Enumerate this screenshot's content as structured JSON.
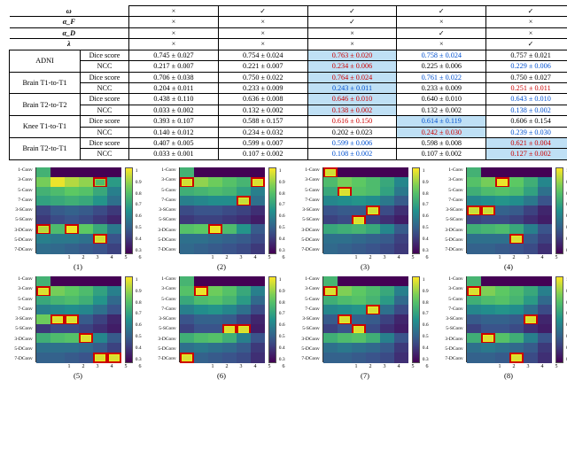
{
  "header_rows": [
    "ω",
    "α_F",
    "α_D",
    "λ"
  ],
  "col_marks": [
    [
      "×",
      "✓",
      "✓",
      "✓",
      "✓"
    ],
    [
      "×",
      "×",
      "✓",
      "×",
      "×"
    ],
    [
      "×",
      "×",
      "×",
      "✓",
      "×"
    ],
    [
      "×",
      "×",
      "×",
      "×",
      "✓"
    ]
  ],
  "datasets": [
    {
      "name": "ADNI",
      "rows": [
        {
          "metric": "Dice score",
          "v": [
            {
              "t": "0.745 ± 0.027"
            },
            {
              "t": "0.754 ± 0.024"
            },
            {
              "t": "0.763 ± 0.020",
              "hl": true,
              "c": "red"
            },
            {
              "t": "0.758 ± 0.024",
              "c": "blue"
            },
            {
              "t": "0.757 ± 0.021"
            }
          ]
        },
        {
          "metric": "NCC",
          "v": [
            {
              "t": "0.217 ± 0.007"
            },
            {
              "t": "0.221 ± 0.007"
            },
            {
              "t": "0.234 ± 0.006",
              "hl": true,
              "c": "red"
            },
            {
              "t": "0.225 ± 0.006"
            },
            {
              "t": "0.229 ± 0.006",
              "c": "blue"
            }
          ]
        }
      ]
    },
    {
      "name": "Brain T1-to-T1",
      "rows": [
        {
          "metric": "Dice score",
          "v": [
            {
              "t": "0.706 ± 0.038"
            },
            {
              "t": "0.750 ± 0.022"
            },
            {
              "t": "0.764 ± 0.024",
              "hl": true,
              "c": "red"
            },
            {
              "t": "0.761 ± 0.022",
              "c": "blue"
            },
            {
              "t": "0.750 ± 0.027"
            }
          ]
        },
        {
          "metric": "NCC",
          "v": [
            {
              "t": "0.204 ± 0.011"
            },
            {
              "t": "0.233 ± 0.009"
            },
            {
              "t": "0.243 ± 0.011",
              "hl": true,
              "c": "blue"
            },
            {
              "t": "0.233 ± 0.009"
            },
            {
              "t": "0.251 ± 0.011",
              "c": "red"
            }
          ]
        }
      ]
    },
    {
      "name": "Brain T2-to-T2",
      "rows": [
        {
          "metric": "Dice score",
          "v": [
            {
              "t": "0.438 ± 0.110"
            },
            {
              "t": "0.636 ± 0.008"
            },
            {
              "t": "0.646 ± 0.010",
              "hl": true,
              "c": "red"
            },
            {
              "t": "0.640 ± 0.010"
            },
            {
              "t": "0.643 ± 0.010",
              "c": "blue"
            }
          ]
        },
        {
          "metric": "NCC",
          "v": [
            {
              "t": "0.033 ± 0.002"
            },
            {
              "t": "0.132 ± 0.002"
            },
            {
              "t": "0.138 ± 0.002",
              "hl": true,
              "c": "red"
            },
            {
              "t": "0.132 ± 0.002"
            },
            {
              "t": "0.138 ± 0.002",
              "c": "blue"
            }
          ]
        }
      ]
    },
    {
      "name": "Knee T1-to-T1",
      "rows": [
        {
          "metric": "Dice score",
          "v": [
            {
              "t": "0.393 ± 0.107"
            },
            {
              "t": "0.588 ± 0.157"
            },
            {
              "t": "0.616 ± 0.150",
              "c": "red"
            },
            {
              "t": "0.614 ± 0.119",
              "hl": true,
              "c": "blue"
            },
            {
              "t": "0.606 ± 0.154"
            }
          ]
        },
        {
          "metric": "NCC",
          "v": [
            {
              "t": "0.140 ± 0.012"
            },
            {
              "t": "0.234 ± 0.032"
            },
            {
              "t": "0.202 ± 0.023"
            },
            {
              "t": "0.242 ± 0.030",
              "hl": true,
              "c": "red"
            },
            {
              "t": "0.239 ± 0.030",
              "c": "blue"
            }
          ]
        }
      ]
    },
    {
      "name": "Brain T2-to-T1",
      "rows": [
        {
          "metric": "Dice score",
          "v": [
            {
              "t": "0.407 ± 0.005"
            },
            {
              "t": "0.599 ± 0.007"
            },
            {
              "t": "0.599 ± 0.006",
              "c": "blue"
            },
            {
              "t": "0.598 ± 0.008"
            },
            {
              "t": "0.621 ± 0.004",
              "hl": true,
              "c": "red"
            }
          ]
        },
        {
          "metric": "NCC",
          "v": [
            {
              "t": "0.033 ± 0.001"
            },
            {
              "t": "0.107 ± 0.002"
            },
            {
              "t": "0.108 ± 0.002",
              "c": "blue"
            },
            {
              "t": "0.107 ± 0.002"
            },
            {
              "t": "0.127 ± 0.002",
              "hl": true,
              "c": "red"
            }
          ]
        }
      ]
    }
  ],
  "chart_data": {
    "type": "heatmap",
    "ylabels": [
      "1-Conv",
      "3-Conv",
      "5-Conv",
      "7-Conv",
      "3-SConv",
      "5-SConv",
      "3-DConv",
      "5-DConv",
      "7-DConv"
    ],
    "xlabels": [
      "1",
      "2",
      "3",
      "4",
      "5",
      "6"
    ],
    "color_range": {
      "min": 0.3,
      "max": 1.0
    },
    "colormap": "viridis",
    "ticks": [
      "1",
      "0.9",
      "0.8",
      "0.7",
      "0.6",
      "0.5",
      "0.4",
      "0.3"
    ],
    "plots": [
      {
        "id": 1,
        "sel": [
          [
            1,
            4
          ],
          [
            6,
            0
          ],
          [
            6,
            2
          ],
          [
            7,
            4
          ]
        ],
        "grid": [
          [
            0.75,
            0.3,
            0.3,
            0.3,
            0.3,
            0.3
          ],
          [
            0.85,
            0.98,
            0.92,
            0.88,
            0.78,
            0.68
          ],
          [
            0.75,
            0.78,
            0.82,
            0.8,
            0.72,
            0.6
          ],
          [
            0.7,
            0.72,
            0.74,
            0.72,
            0.66,
            0.56
          ],
          [
            0.45,
            0.5,
            0.52,
            0.5,
            0.46,
            0.42
          ],
          [
            0.42,
            0.46,
            0.48,
            0.46,
            0.42,
            0.38
          ],
          [
            0.92,
            0.78,
            0.98,
            0.82,
            0.72,
            0.58
          ],
          [
            0.6,
            0.58,
            0.58,
            0.56,
            0.95,
            0.48
          ],
          [
            0.55,
            0.54,
            0.52,
            0.5,
            0.48,
            0.44
          ]
        ]
      },
      {
        "id": 2,
        "sel": [
          [
            1,
            0
          ],
          [
            1,
            5
          ],
          [
            3,
            4
          ],
          [
            6,
            2
          ]
        ],
        "grid": [
          [
            0.75,
            0.3,
            0.3,
            0.3,
            0.3,
            0.3
          ],
          [
            0.95,
            0.88,
            0.84,
            0.8,
            0.76,
            0.96
          ],
          [
            0.74,
            0.76,
            0.78,
            0.76,
            0.7,
            0.6
          ],
          [
            0.6,
            0.62,
            0.64,
            0.64,
            0.94,
            0.56
          ],
          [
            0.46,
            0.48,
            0.48,
            0.46,
            0.44,
            0.4
          ],
          [
            0.42,
            0.44,
            0.44,
            0.42,
            0.4,
            0.36
          ],
          [
            0.8,
            0.82,
            0.98,
            0.78,
            0.66,
            0.5
          ],
          [
            0.56,
            0.56,
            0.54,
            0.52,
            0.5,
            0.46
          ],
          [
            0.54,
            0.52,
            0.5,
            0.48,
            0.46,
            0.42
          ]
        ]
      },
      {
        "id": 3,
        "sel": [
          [
            0,
            0
          ],
          [
            2,
            1
          ],
          [
            4,
            3
          ],
          [
            5,
            2
          ]
        ],
        "grid": [
          [
            0.95,
            0.3,
            0.3,
            0.3,
            0.3,
            0.3
          ],
          [
            0.78,
            0.85,
            0.82,
            0.78,
            0.72,
            0.62
          ],
          [
            0.72,
            0.96,
            0.8,
            0.78,
            0.7,
            0.58
          ],
          [
            0.62,
            0.64,
            0.66,
            0.64,
            0.58,
            0.5
          ],
          [
            0.48,
            0.5,
            0.5,
            0.95,
            0.46,
            0.4
          ],
          [
            0.44,
            0.46,
            0.96,
            0.44,
            0.4,
            0.36
          ],
          [
            0.72,
            0.74,
            0.76,
            0.72,
            0.62,
            0.5
          ],
          [
            0.56,
            0.56,
            0.54,
            0.52,
            0.5,
            0.44
          ],
          [
            0.54,
            0.52,
            0.5,
            0.48,
            0.46,
            0.42
          ]
        ]
      },
      {
        "id": 4,
        "sel": [
          [
            1,
            2
          ],
          [
            4,
            0
          ],
          [
            4,
            1
          ],
          [
            7,
            3
          ]
        ],
        "grid": [
          [
            0.75,
            0.3,
            0.3,
            0.3,
            0.3,
            0.3
          ],
          [
            0.8,
            0.85,
            0.98,
            0.82,
            0.74,
            0.62
          ],
          [
            0.74,
            0.78,
            0.8,
            0.78,
            0.7,
            0.56
          ],
          [
            0.62,
            0.64,
            0.66,
            0.64,
            0.58,
            0.48
          ],
          [
            0.94,
            0.94,
            0.52,
            0.5,
            0.44,
            0.38
          ],
          [
            0.44,
            0.46,
            0.46,
            0.44,
            0.4,
            0.36
          ],
          [
            0.74,
            0.76,
            0.78,
            0.72,
            0.6,
            0.48
          ],
          [
            0.56,
            0.56,
            0.56,
            0.96,
            0.5,
            0.44
          ],
          [
            0.52,
            0.52,
            0.5,
            0.48,
            0.46,
            0.4
          ]
        ]
      },
      {
        "id": 5,
        "sel": [
          [
            1,
            0
          ],
          [
            4,
            1
          ],
          [
            4,
            2
          ],
          [
            6,
            3
          ],
          [
            8,
            4
          ],
          [
            8,
            5
          ]
        ],
        "grid": [
          [
            0.75,
            0.3,
            0.3,
            0.3,
            0.3,
            0.3
          ],
          [
            0.96,
            0.85,
            0.82,
            0.78,
            0.7,
            0.6
          ],
          [
            0.72,
            0.76,
            0.78,
            0.74,
            0.66,
            0.54
          ],
          [
            0.6,
            0.62,
            0.64,
            0.62,
            0.56,
            0.48
          ],
          [
            0.84,
            0.96,
            0.96,
            0.5,
            0.44,
            0.38
          ],
          [
            0.42,
            0.46,
            0.46,
            0.44,
            0.4,
            0.36
          ],
          [
            0.74,
            0.78,
            0.8,
            0.96,
            0.62,
            0.5
          ],
          [
            0.56,
            0.56,
            0.56,
            0.54,
            0.5,
            0.44
          ],
          [
            0.52,
            0.52,
            0.5,
            0.48,
            0.96,
            0.96
          ]
        ]
      },
      {
        "id": 6,
        "sel": [
          [
            1,
            1
          ],
          [
            5,
            3
          ],
          [
            5,
            4
          ],
          [
            8,
            0
          ]
        ],
        "grid": [
          [
            0.76,
            0.3,
            0.3,
            0.3,
            0.3,
            0.3
          ],
          [
            0.8,
            0.98,
            0.84,
            0.8,
            0.72,
            0.6
          ],
          [
            0.72,
            0.78,
            0.8,
            0.76,
            0.68,
            0.54
          ],
          [
            0.6,
            0.64,
            0.66,
            0.62,
            0.56,
            0.46
          ],
          [
            0.48,
            0.52,
            0.52,
            0.5,
            0.44,
            0.38
          ],
          [
            0.44,
            0.48,
            0.48,
            0.96,
            0.96,
            0.36
          ],
          [
            0.74,
            0.78,
            0.8,
            0.74,
            0.6,
            0.48
          ],
          [
            0.56,
            0.58,
            0.56,
            0.54,
            0.5,
            0.42
          ],
          [
            0.96,
            0.52,
            0.5,
            0.48,
            0.46,
            0.4
          ]
        ]
      },
      {
        "id": 7,
        "sel": [
          [
            1,
            0
          ],
          [
            3,
            3
          ],
          [
            4,
            1
          ],
          [
            5,
            2
          ]
        ],
        "grid": [
          [
            0.76,
            0.3,
            0.3,
            0.3,
            0.3,
            0.3
          ],
          [
            0.96,
            0.86,
            0.82,
            0.78,
            0.72,
            0.6
          ],
          [
            0.74,
            0.78,
            0.8,
            0.76,
            0.68,
            0.54
          ],
          [
            0.62,
            0.64,
            0.66,
            0.96,
            0.56,
            0.46
          ],
          [
            0.5,
            0.96,
            0.52,
            0.5,
            0.44,
            0.38
          ],
          [
            0.44,
            0.48,
            0.96,
            0.46,
            0.4,
            0.36
          ],
          [
            0.74,
            0.78,
            0.8,
            0.74,
            0.6,
            0.48
          ],
          [
            0.56,
            0.58,
            0.56,
            0.54,
            0.5,
            0.42
          ],
          [
            0.52,
            0.52,
            0.5,
            0.48,
            0.46,
            0.4
          ]
        ]
      },
      {
        "id": 8,
        "sel": [
          [
            1,
            0
          ],
          [
            4,
            4
          ],
          [
            6,
            1
          ],
          [
            8,
            3
          ]
        ],
        "grid": [
          [
            0.76,
            0.3,
            0.3,
            0.3,
            0.3,
            0.3
          ],
          [
            0.96,
            0.86,
            0.82,
            0.78,
            0.72,
            0.6
          ],
          [
            0.74,
            0.78,
            0.8,
            0.76,
            0.68,
            0.54
          ],
          [
            0.62,
            0.64,
            0.66,
            0.64,
            0.56,
            0.46
          ],
          [
            0.5,
            0.52,
            0.52,
            0.5,
            0.96,
            0.38
          ],
          [
            0.44,
            0.48,
            0.48,
            0.46,
            0.4,
            0.36
          ],
          [
            0.74,
            0.96,
            0.8,
            0.74,
            0.6,
            0.48
          ],
          [
            0.56,
            0.58,
            0.56,
            0.54,
            0.5,
            0.42
          ],
          [
            0.52,
            0.52,
            0.5,
            0.96,
            0.46,
            0.4
          ]
        ]
      }
    ]
  }
}
